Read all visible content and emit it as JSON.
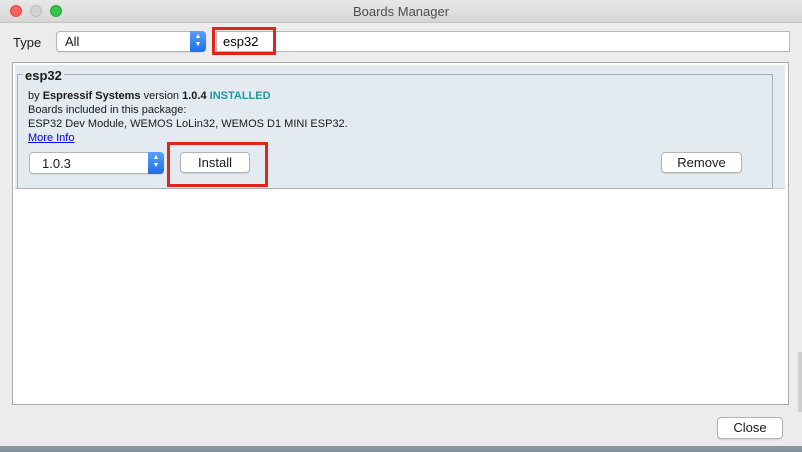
{
  "window": {
    "title": "Boards Manager"
  },
  "filter": {
    "type_label": "Type",
    "type_value": "All",
    "search_value": "esp32"
  },
  "board": {
    "name": "esp32",
    "by_prefix": "by",
    "author": "Espressif Systems",
    "version_prefix": "version",
    "installed_version": "1.0.4",
    "status": "INSTALLED",
    "boards_label": "Boards included in this package:",
    "boards_list": "ESP32 Dev Module, WEMOS LoLin32, WEMOS D1 MINI ESP32.",
    "more_info": "More Info",
    "selected_version": "1.0.3",
    "install_label": "Install",
    "remove_label": "Remove"
  },
  "footer": {
    "close_label": "Close"
  },
  "colors": {
    "installed": "#1f9a9e",
    "highlight": "#e0241c",
    "entry_bg": "#e3eaf0"
  }
}
